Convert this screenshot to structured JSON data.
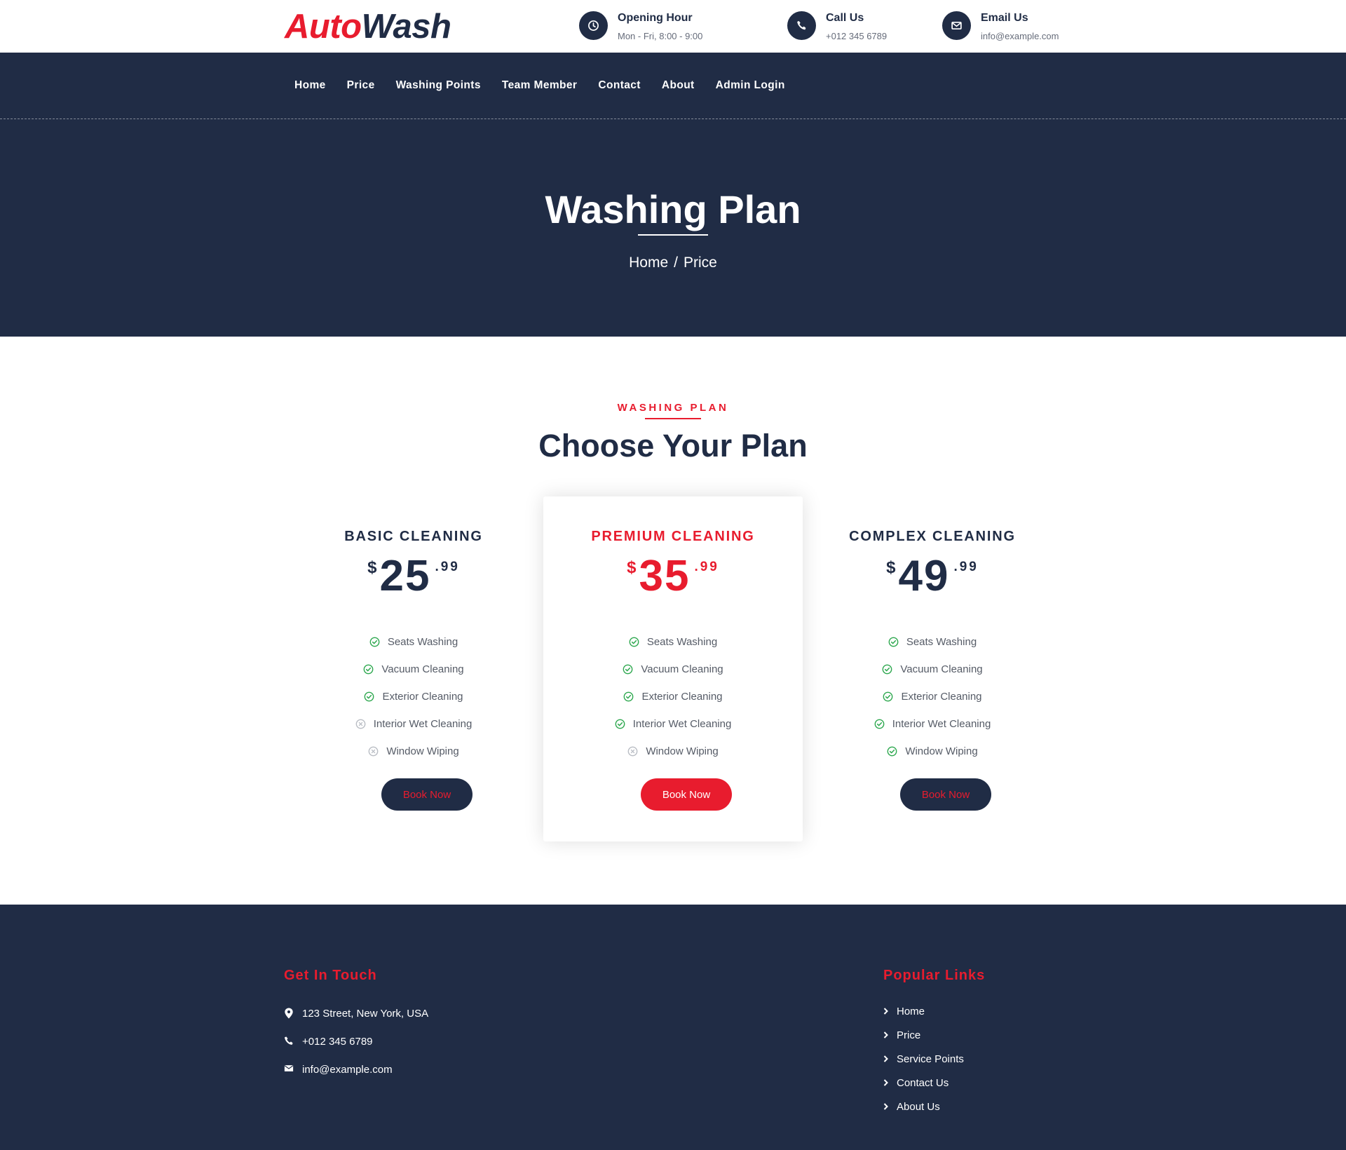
{
  "brand": {
    "part1": "Auto",
    "part2": "Wash"
  },
  "header_info": [
    {
      "title": "Opening Hour",
      "detail": "Mon - Fri, 8:00 - 9:00",
      "icon": "clock-icon"
    },
    {
      "title": "Call Us",
      "detail": "+012 345 6789",
      "icon": "phone-icon"
    },
    {
      "title": "Email Us",
      "detail": "info@example.com",
      "icon": "envelope-icon"
    }
  ],
  "nav": [
    "Home",
    "Price",
    "Washing Points",
    "Team Member",
    "Contact",
    "About",
    "Admin Login"
  ],
  "hero": {
    "title": "Washing Plan",
    "crumbs": [
      "Home",
      "Price"
    ],
    "separator": "/"
  },
  "section": {
    "label": "WASHING PLAN",
    "title": "Choose Your Plan"
  },
  "plans": [
    {
      "name": "BASIC CLEANING",
      "currency": "$",
      "amount": "25",
      "cents": ".99",
      "features": [
        {
          "label": "Seats Washing",
          "included": true
        },
        {
          "label": "Vacuum Cleaning",
          "included": true
        },
        {
          "label": "Exterior Cleaning",
          "included": true
        },
        {
          "label": "Interior Wet Cleaning",
          "included": false
        },
        {
          "label": "Window Wiping",
          "included": false
        }
      ],
      "button": "Book Now"
    },
    {
      "name": "PREMIUM CLEANING",
      "currency": "$",
      "amount": "35",
      "cents": ".99",
      "features": [
        {
          "label": "Seats Washing",
          "included": true
        },
        {
          "label": "Vacuum Cleaning",
          "included": true
        },
        {
          "label": "Exterior Cleaning",
          "included": true
        },
        {
          "label": "Interior Wet Cleaning",
          "included": true
        },
        {
          "label": "Window Wiping",
          "included": false
        }
      ],
      "button": "Book Now"
    },
    {
      "name": "COMPLEX CLEANING",
      "currency": "$",
      "amount": "49",
      "cents": ".99",
      "features": [
        {
          "label": "Seats Washing",
          "included": true
        },
        {
          "label": "Vacuum Cleaning",
          "included": true
        },
        {
          "label": "Exterior Cleaning",
          "included": true
        },
        {
          "label": "Interior Wet Cleaning",
          "included": true
        },
        {
          "label": "Window Wiping",
          "included": true
        }
      ],
      "button": "Book Now"
    }
  ],
  "footer": {
    "contact_title": "Get In Touch",
    "address": "123 Street, New York, USA",
    "phone": "+012 345 6789",
    "email": "info@example.com",
    "links_title": "Popular Links",
    "links": [
      "Home",
      "Price",
      "Service Points",
      "Contact Us",
      "About Us"
    ]
  },
  "colors": {
    "navy": "#202c45",
    "accent": "#e81c2e",
    "check": "#2ea84f",
    "cross": "#b9bdc4"
  }
}
